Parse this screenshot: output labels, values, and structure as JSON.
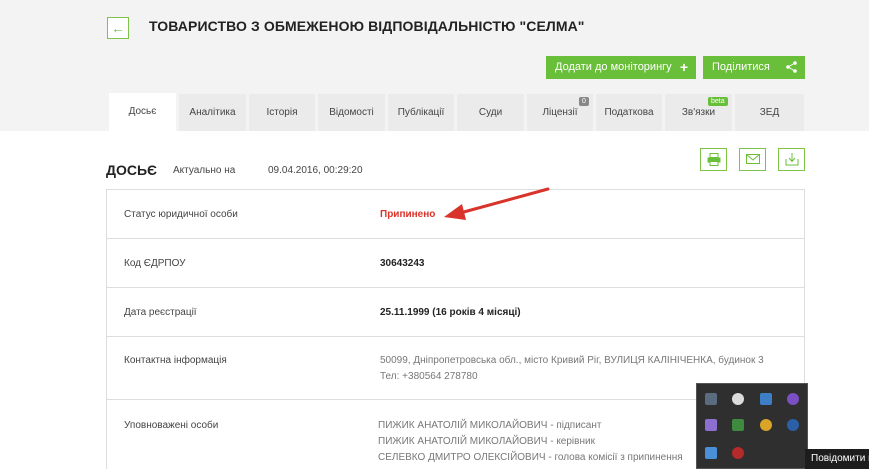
{
  "header": {
    "back_icon": "arrow-left-icon",
    "title": "ТОВАРИСТВО З ОБМЕЖЕНОЮ ВІДПОВІДАЛЬНІСТЮ \"СЕЛМА\""
  },
  "actions": {
    "monitor_label": "Додати до моніторингу",
    "monitor_icon": "plus-icon",
    "share_label": "Поділитися",
    "share_icon": "share-icon"
  },
  "tabs": [
    {
      "label": "Досьє",
      "active": true
    },
    {
      "label": "Аналітика"
    },
    {
      "label": "Історія"
    },
    {
      "label": "Відомості"
    },
    {
      "label": "Публікації"
    },
    {
      "label": "Суди"
    },
    {
      "label": "Ліцензії",
      "badge": "0"
    },
    {
      "label": "Податкова"
    },
    {
      "label": "Зв'язки",
      "badge": "beta"
    },
    {
      "label": "ЗЕД"
    }
  ],
  "dossier": {
    "title": "ДОСЬЄ",
    "actual_label": "Актуально на",
    "actual_date": "09.04.2016, 00:29:20",
    "tool_icons": [
      "print-icon",
      "mail-icon",
      "download-icon"
    ]
  },
  "rows": {
    "status": {
      "label": "Статус юридичної особи",
      "value": "Припинено"
    },
    "code": {
      "label": "Код ЄДРПОУ",
      "value": "30643243"
    },
    "reg": {
      "label": "Дата реєстрації",
      "value": "25.11.1999 (16 років 4 місяці)"
    },
    "contact": {
      "label": "Контактна інформація",
      "address": "50099, Дніпропетровська обл., місто Кривий Ріг, ВУЛИЦЯ КАЛІНІЧЕНКА, будинок 3",
      "phone": "Тел: +380564 278780"
    },
    "persons": {
      "label": "Уповноважені особи",
      "lines": [
        "ПИЖИК АНАТОЛІЙ МИКОЛАЙОВИЧ - підписант",
        "ПИЖИК АНАТОЛІЙ МИКОЛАЙОВИЧ - керівник",
        "СЕЛЕВКО ДМИТРО ОЛЕКСІЙОВИЧ - голова комісії з припинення"
      ]
    }
  },
  "annotation_color": "#d9342b",
  "accent_color": "#6abf3a",
  "system": {
    "notification_text": "Повідомити п",
    "tray_icons": [
      "monitor-icon",
      "cloud-icon",
      "app-icon",
      "viber-icon",
      "pen-icon",
      "screen-icon",
      "coin-icon",
      "bluetooth-icon",
      "shield-icon",
      "record-icon"
    ]
  }
}
